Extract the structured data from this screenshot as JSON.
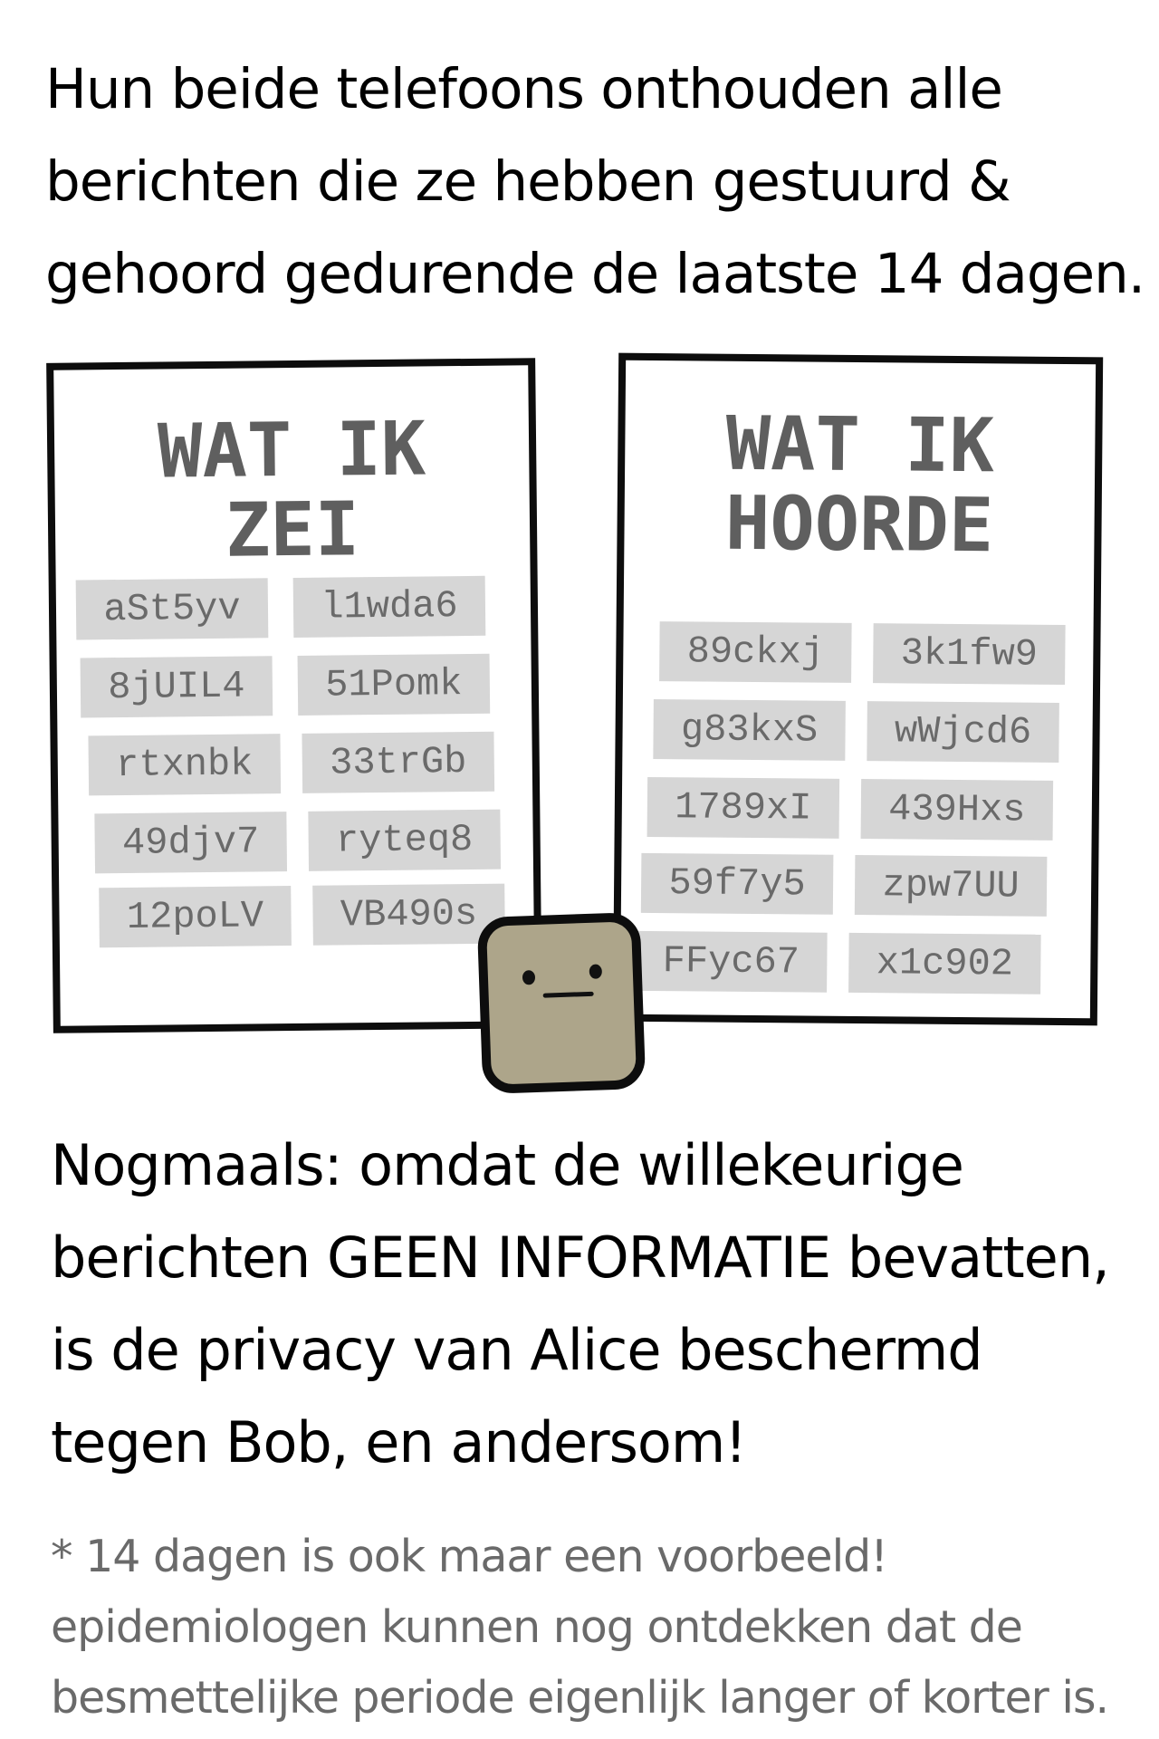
{
  "intro": {
    "lines": [
      "Hun beide telefoons onthouden alle",
      "berichten die ze hebben gestuurd &",
      "gehoord gedurende de laatste 14 dagen."
    ]
  },
  "left_panel": {
    "title_lines": [
      "WAT  IK",
      "ZEI"
    ],
    "messages": [
      "aSt5yv",
      "l1wda6",
      "8jUIL4",
      "51Pomk",
      "rtxnbk",
      "33trGb",
      "49djv7",
      "ryteq8",
      "12poLV",
      "VB490s"
    ]
  },
  "right_panel": {
    "title_lines": [
      "WAT  IK",
      "HOORDE"
    ],
    "messages": [
      "89ckxj",
      "3k1fw9",
      "g83kxS",
      "wWjcd6",
      "1789xI",
      "439Hxs",
      "59f7y5",
      "zpw7UU",
      "FFyc67",
      "x1c902"
    ]
  },
  "conclusion": {
    "lines": [
      "Nogmaals: omdat de willekeurige",
      "berichten GEEN INFORMATIE bevatten,",
      "is de privacy van Alice beschermd",
      "tegen Bob, en andersom!"
    ]
  },
  "footnote": {
    "lines": [
      "* 14 dagen is ook maar een voorbeeld!",
      "epidemiologen kunnen nog ontdekken dat de",
      "besmettelijke periode eigenlijk langer of korter is."
    ]
  },
  "colors": {
    "ink": "#0d0d0d",
    "message_bg": "#d6d6d6",
    "message_text": "#6a6a6a",
    "title_text": "#5f5f5f",
    "character_fill": "#ada58a"
  }
}
